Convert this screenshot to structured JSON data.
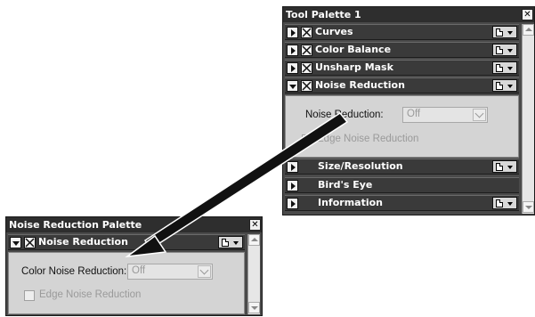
{
  "tool_palette": {
    "title": "Tool Palette 1",
    "close_glyph": "✕",
    "rows": [
      {
        "label": "Curves",
        "expanded": false,
        "icon": "expand-triangle-icon",
        "enabled": true,
        "has_menu": true
      },
      {
        "label": "Color Balance",
        "expanded": false,
        "icon": "expand-triangle-icon",
        "enabled": true,
        "has_menu": true
      },
      {
        "label": "Unsharp Mask",
        "expanded": false,
        "icon": "expand-triangle-icon",
        "enabled": true,
        "has_menu": true
      },
      {
        "label": "Noise Reduction",
        "expanded": true,
        "icon": "collapse-triangle-icon",
        "enabled": true,
        "has_menu": true
      },
      {
        "label": "Size/Resolution",
        "expanded": false,
        "icon": "expand-triangle-icon",
        "enabled": false,
        "has_menu": true
      },
      {
        "label": "Bird's Eye",
        "expanded": false,
        "icon": "expand-triangle-icon",
        "enabled": false,
        "has_menu": false
      },
      {
        "label": "Information",
        "expanded": false,
        "icon": "expand-triangle-icon",
        "enabled": false,
        "has_menu": true
      }
    ],
    "noise_panel": {
      "color_noise_label": "Noise Reduction:",
      "color_noise_value": "Off",
      "edge_noise_label": "Edge Noise Reduction"
    }
  },
  "noise_palette": {
    "title": "Noise Reduction Palette",
    "close_glyph": "✕",
    "header_label": "Noise Reduction",
    "color_noise_label": "Color Noise Reduction:",
    "color_noise_value": "Off",
    "edge_noise_label": "Edge Noise Reduction"
  },
  "colors": {
    "palette_bg": "#4a4a4a",
    "panel_bg": "#d4d4d4",
    "title_bg": "#2e2e2e",
    "arrow": "#111111"
  }
}
